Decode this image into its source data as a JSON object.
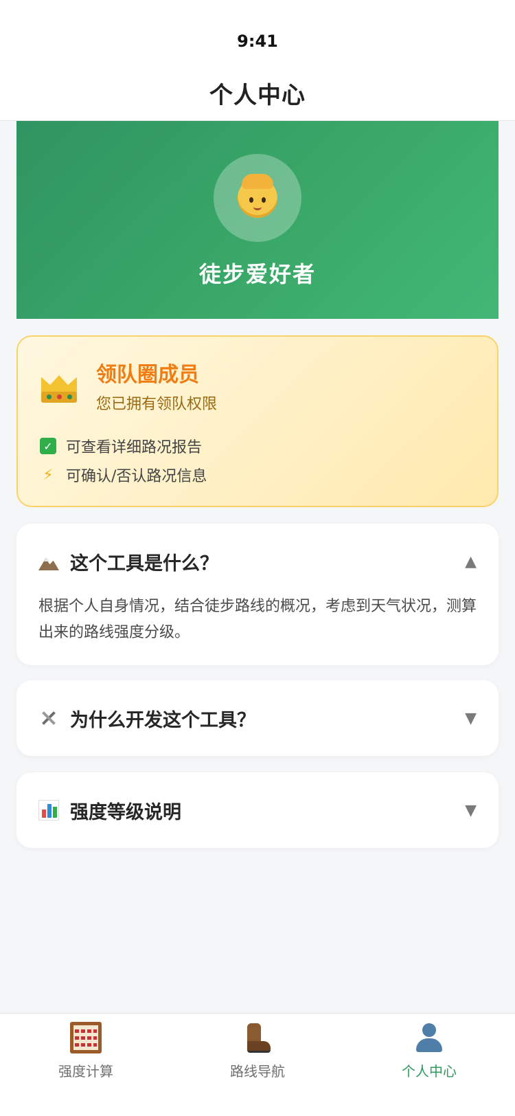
{
  "status_bar": {
    "time": "9:41"
  },
  "nav": {
    "title": "个人中心"
  },
  "profile": {
    "name": "徒步爱好者",
    "avatar_icon": "person-icon"
  },
  "membership": {
    "title": "领队圈成员",
    "subtitle": "您已拥有领队权限",
    "permissions": [
      {
        "icon": "check-icon",
        "text": "可查看详细路况报告"
      },
      {
        "icon": "lightning-icon",
        "text": "可确认/否认路况信息"
      }
    ],
    "colors": {
      "title": "#ef7d14",
      "border": "#f7d36a"
    }
  },
  "faq": [
    {
      "icon": "mountain-icon",
      "title": "这个工具是什么？",
      "expanded": true,
      "arrow": "▲",
      "body": "根据个人自身情况，结合徒步路线的概况，考虑到天气状况，测算出来的路线强度分级。"
    },
    {
      "icon": "tools-icon",
      "title": "为什么开发这个工具？",
      "expanded": false,
      "arrow": "▼"
    },
    {
      "icon": "bar-chart-icon",
      "title": "强度等级说明",
      "expanded": false,
      "arrow": "▼"
    }
  ],
  "tabs": [
    {
      "icon": "abacus-icon",
      "label": "强度计算",
      "active": false
    },
    {
      "icon": "hiking-boot-icon",
      "label": "路线导航",
      "active": false
    },
    {
      "icon": "user-icon",
      "label": "个人中心",
      "active": true
    }
  ],
  "theme": {
    "primary_green": "#2e9a5c",
    "hero_gradient_start": "#2f9462",
    "hero_gradient_end": "#42b776"
  }
}
